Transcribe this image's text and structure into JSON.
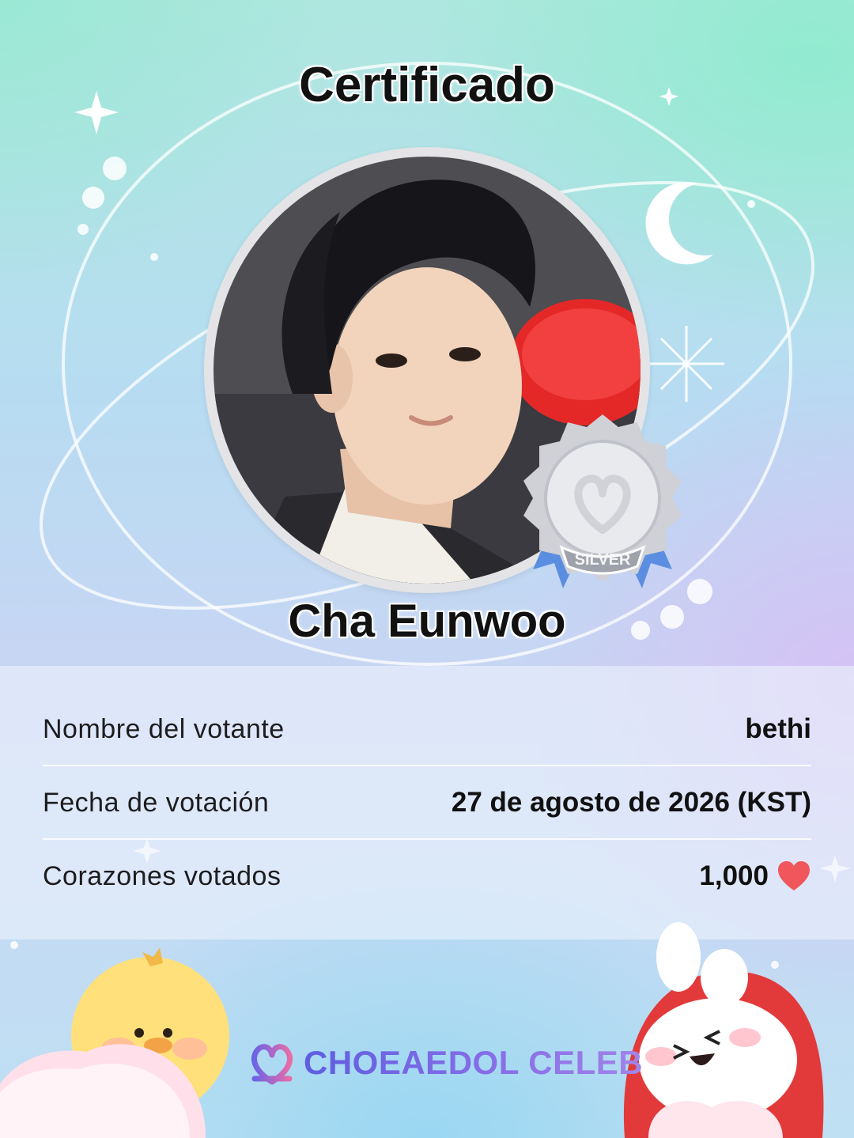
{
  "certificate": {
    "title": "Certificado",
    "celeb_name": "Cha Eunwoo",
    "badge_label": "SILVER",
    "badge_level": "silver"
  },
  "details": [
    {
      "label": "Nombre del votante",
      "value": "bethi"
    },
    {
      "label": "Fecha de votación",
      "value": "27 de agosto de 2026 (KST)"
    },
    {
      "label": "Corazones votados",
      "value": "1,000",
      "icon": "heart-icon"
    }
  ],
  "brand": {
    "name": "CHOEAEDOL CELEB",
    "logo": "heart-logo-icon"
  },
  "colors": {
    "heart": "#f0565c",
    "brand": "#6a63e6",
    "badge_ribbon": "#5b8ee0"
  }
}
